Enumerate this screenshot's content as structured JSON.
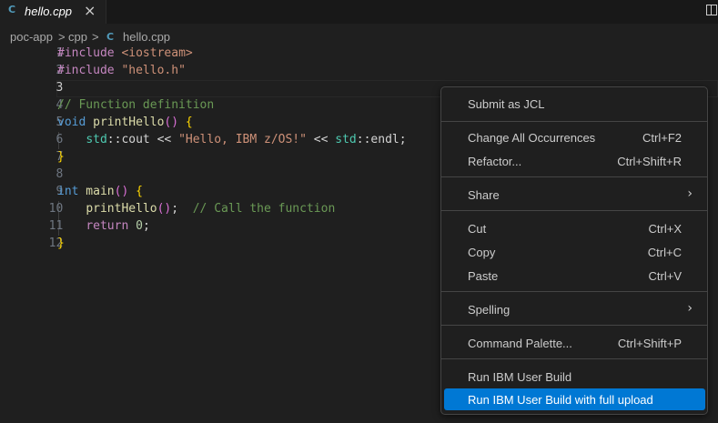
{
  "tab": {
    "label": "hello.cpp",
    "icon": "c-file-icon",
    "close": "×"
  },
  "breadcrumb": {
    "root": "poc-app",
    "folder": "cpp",
    "file": "hello.cpp",
    "sep": ">",
    "file_icon": "C"
  },
  "editor": {
    "line_numbers": [
      "1",
      "2",
      "3",
      "4",
      "5",
      "6",
      "7",
      "8",
      "9",
      "10",
      "11",
      "12"
    ],
    "lines": {
      "l1_pp": "#include",
      "l1_inc": " <iostream>",
      "l2_pp": "#include",
      "l2_inc": " \"hello.h\"",
      "l4_cm": "// Function definition",
      "l5_kw": "void",
      "l5_fn": " printHello",
      "l5_paren": "()",
      "l5_brace": " {",
      "l6_indent": "    ",
      "l6_ns1": "std",
      "l6_op1": "::cout << ",
      "l6_str": "\"Hello, IBM z/OS!\"",
      "l6_op2": " << ",
      "l6_ns2": "std",
      "l6_op3": "::endl;",
      "l7_brace": "}",
      "l9_kw": "int",
      "l9_fn": " main",
      "l9_paren": "()",
      "l9_brace": " {",
      "l10_indent": "    ",
      "l10_fn": "printHello",
      "l10_paren": "()",
      "l10_semi": ";  ",
      "l10_cm": "// Call the function",
      "l11_indent": "    ",
      "l11_kw": "return",
      "l11_sp": " ",
      "l11_num": "0",
      "l11_semi": ";",
      "l12_brace": "}"
    }
  },
  "context_menu": {
    "items": [
      {
        "label": "Submit as JCL",
        "shortcut": ""
      },
      {
        "label": "Change All Occurrences",
        "shortcut": "Ctrl+F2"
      },
      {
        "label": "Refactor...",
        "shortcut": "Ctrl+Shift+R"
      },
      {
        "label": "Share",
        "shortcut": "",
        "submenu": "›"
      },
      {
        "label": "Cut",
        "shortcut": "Ctrl+X"
      },
      {
        "label": "Copy",
        "shortcut": "Ctrl+C"
      },
      {
        "label": "Paste",
        "shortcut": "Ctrl+V"
      },
      {
        "label": "Spelling",
        "shortcut": "",
        "submenu": "›"
      },
      {
        "label": "Command Palette...",
        "shortcut": "Ctrl+Shift+P"
      },
      {
        "label": "Run IBM User Build",
        "shortcut": ""
      },
      {
        "label": "Run IBM User Build with full upload",
        "shortcut": ""
      }
    ],
    "selected_index": 10
  },
  "colors": {
    "accent": "#0078d4",
    "background": "#1f1f1f"
  }
}
